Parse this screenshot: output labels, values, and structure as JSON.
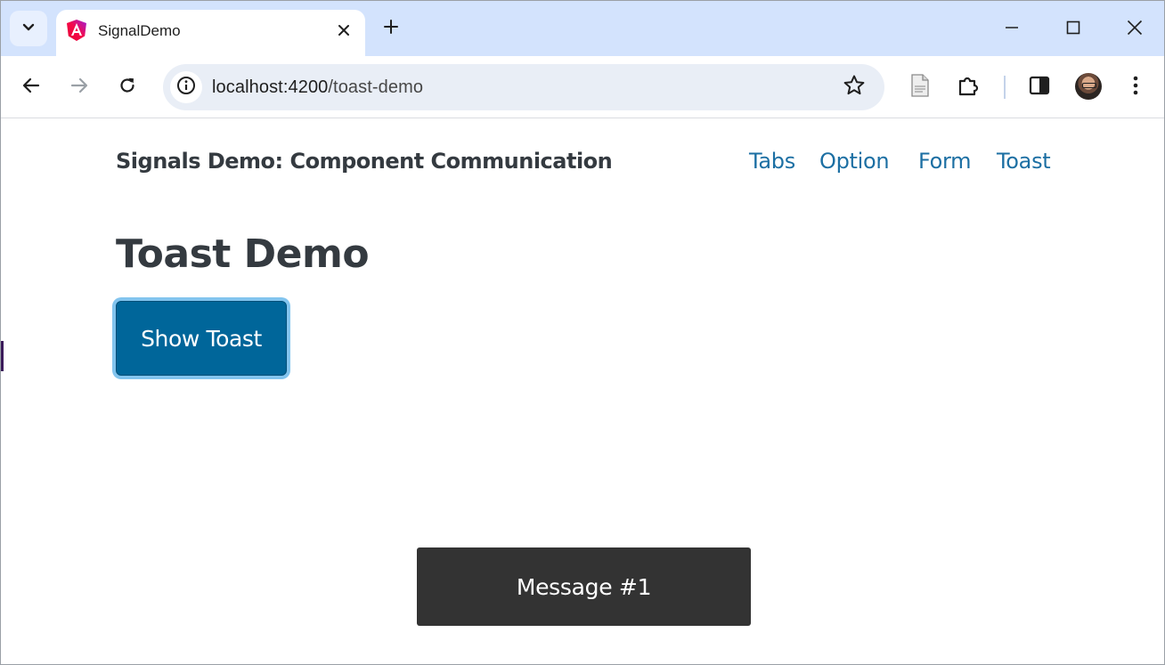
{
  "browser": {
    "tab": {
      "title": "SignalDemo",
      "favicon": "angular-icon"
    },
    "address_bar": {
      "host": "localhost:4200",
      "path": "/toast-demo"
    },
    "icons": {
      "tab_search": "chevron-down-icon",
      "new_tab": "plus-icon",
      "back": "arrow-left-icon",
      "forward": "arrow-right-icon",
      "reload": "reload-icon",
      "site_info": "info-icon",
      "bookmark": "star-icon",
      "reading_list": "document-icon",
      "extensions": "puzzle-icon",
      "side_panel": "side-panel-icon",
      "menu": "kebab-menu-icon"
    }
  },
  "app": {
    "brand": "Signals Demo: Component Communication",
    "nav": [
      {
        "label": "Tabs"
      },
      {
        "label": "Option"
      },
      {
        "label": "Form"
      },
      {
        "label": "Toast"
      }
    ],
    "page_title": "Toast Demo",
    "show_toast_button": "Show Toast",
    "toast_message": "Message #1"
  },
  "colors": {
    "tabstrip": "#d3e3fd",
    "link": "#1c6fa3",
    "button": "#00669a",
    "button_focus_ring": "#82c4ee",
    "toast_bg": "#333333",
    "text_dark": "#343a40"
  }
}
